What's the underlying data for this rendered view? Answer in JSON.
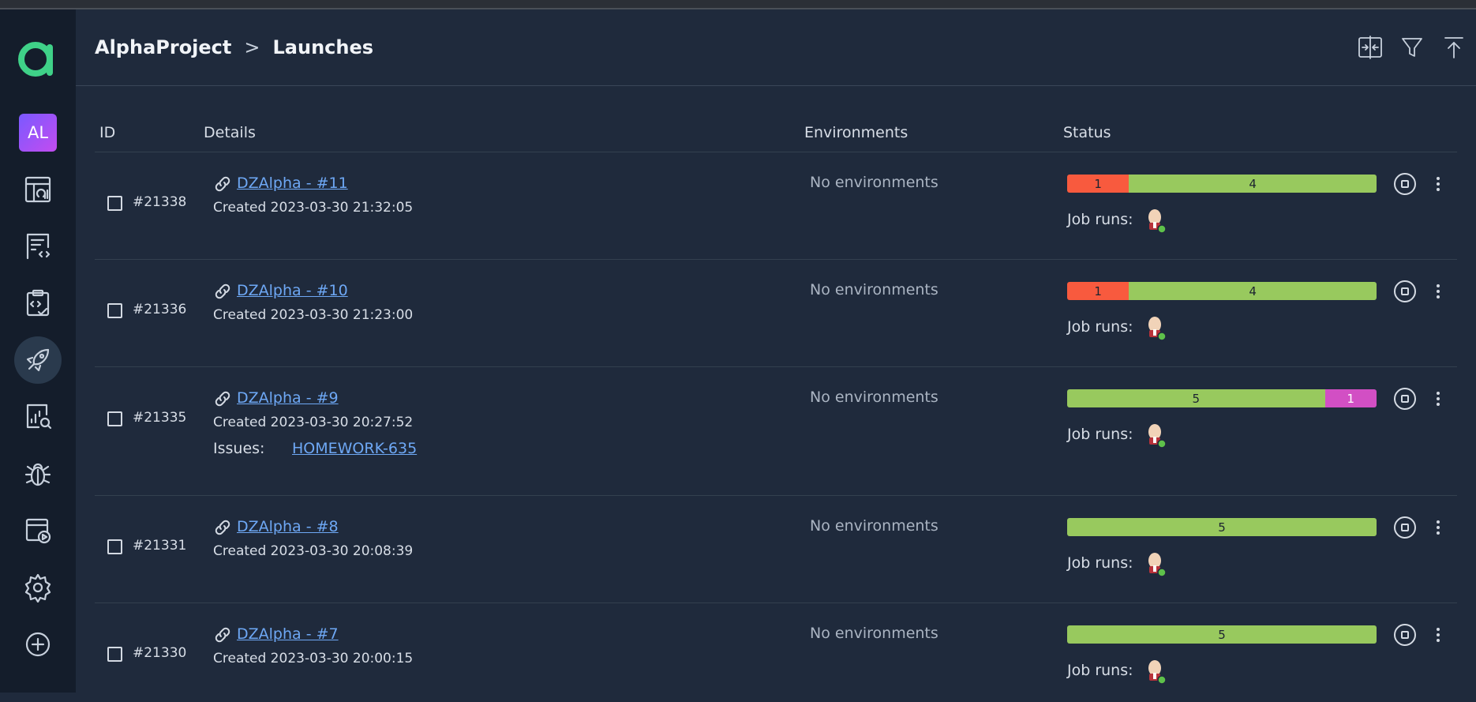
{
  "sidebar": {
    "avatar_initials": "AL",
    "items": [
      {
        "icon": "dashboard-icon"
      },
      {
        "icon": "test-cases-icon"
      },
      {
        "icon": "test-runs-icon"
      },
      {
        "icon": "launches-icon",
        "active": true
      },
      {
        "icon": "analytics-icon"
      },
      {
        "icon": "defects-icon"
      },
      {
        "icon": "jobs-icon"
      },
      {
        "icon": "settings-icon"
      },
      {
        "icon": "add-project-icon"
      }
    ]
  },
  "header": {
    "project": "AlphaProject",
    "separator": ">",
    "page": "Launches",
    "actions": [
      "compare-icon",
      "filter-icon",
      "export-icon"
    ]
  },
  "columns": {
    "id": "ID",
    "details": "Details",
    "environments": "Environments",
    "status": "Status"
  },
  "colors": {
    "failed": "#f85a3e",
    "passed": "#98c95e",
    "skipped": "#d24fc4",
    "link": "#6ea8f5"
  },
  "job_runs_label": "Job runs:",
  "issues_label": "Issues:",
  "launches": [
    {
      "id": "#21338",
      "name": "DZAlpha - #11",
      "created": "Created 2023-03-30 21:32:05",
      "env": "No environments",
      "segments": [
        {
          "type": "failed",
          "value": 1
        },
        {
          "type": "passed",
          "value": 4
        }
      ]
    },
    {
      "id": "#21336",
      "name": "DZAlpha - #10",
      "created": "Created 2023-03-30 21:23:00",
      "env": "No environments",
      "segments": [
        {
          "type": "failed",
          "value": 1
        },
        {
          "type": "passed",
          "value": 4
        }
      ]
    },
    {
      "id": "#21335",
      "name": "DZAlpha - #9",
      "created": "Created 2023-03-30 20:27:52",
      "env": "No environments",
      "issue": "HOMEWORK-635",
      "segments": [
        {
          "type": "passed",
          "value": 5
        },
        {
          "type": "skipped",
          "value": 1
        }
      ]
    },
    {
      "id": "#21331",
      "name": "DZAlpha - #8",
      "created": "Created 2023-03-30 20:08:39",
      "env": "No environments",
      "segments": [
        {
          "type": "passed",
          "value": 5
        }
      ]
    },
    {
      "id": "#21330",
      "name": "DZAlpha - #7",
      "created": "Created 2023-03-30 20:00:15",
      "env": "No environments",
      "segments": [
        {
          "type": "passed",
          "value": 5
        }
      ]
    }
  ]
}
